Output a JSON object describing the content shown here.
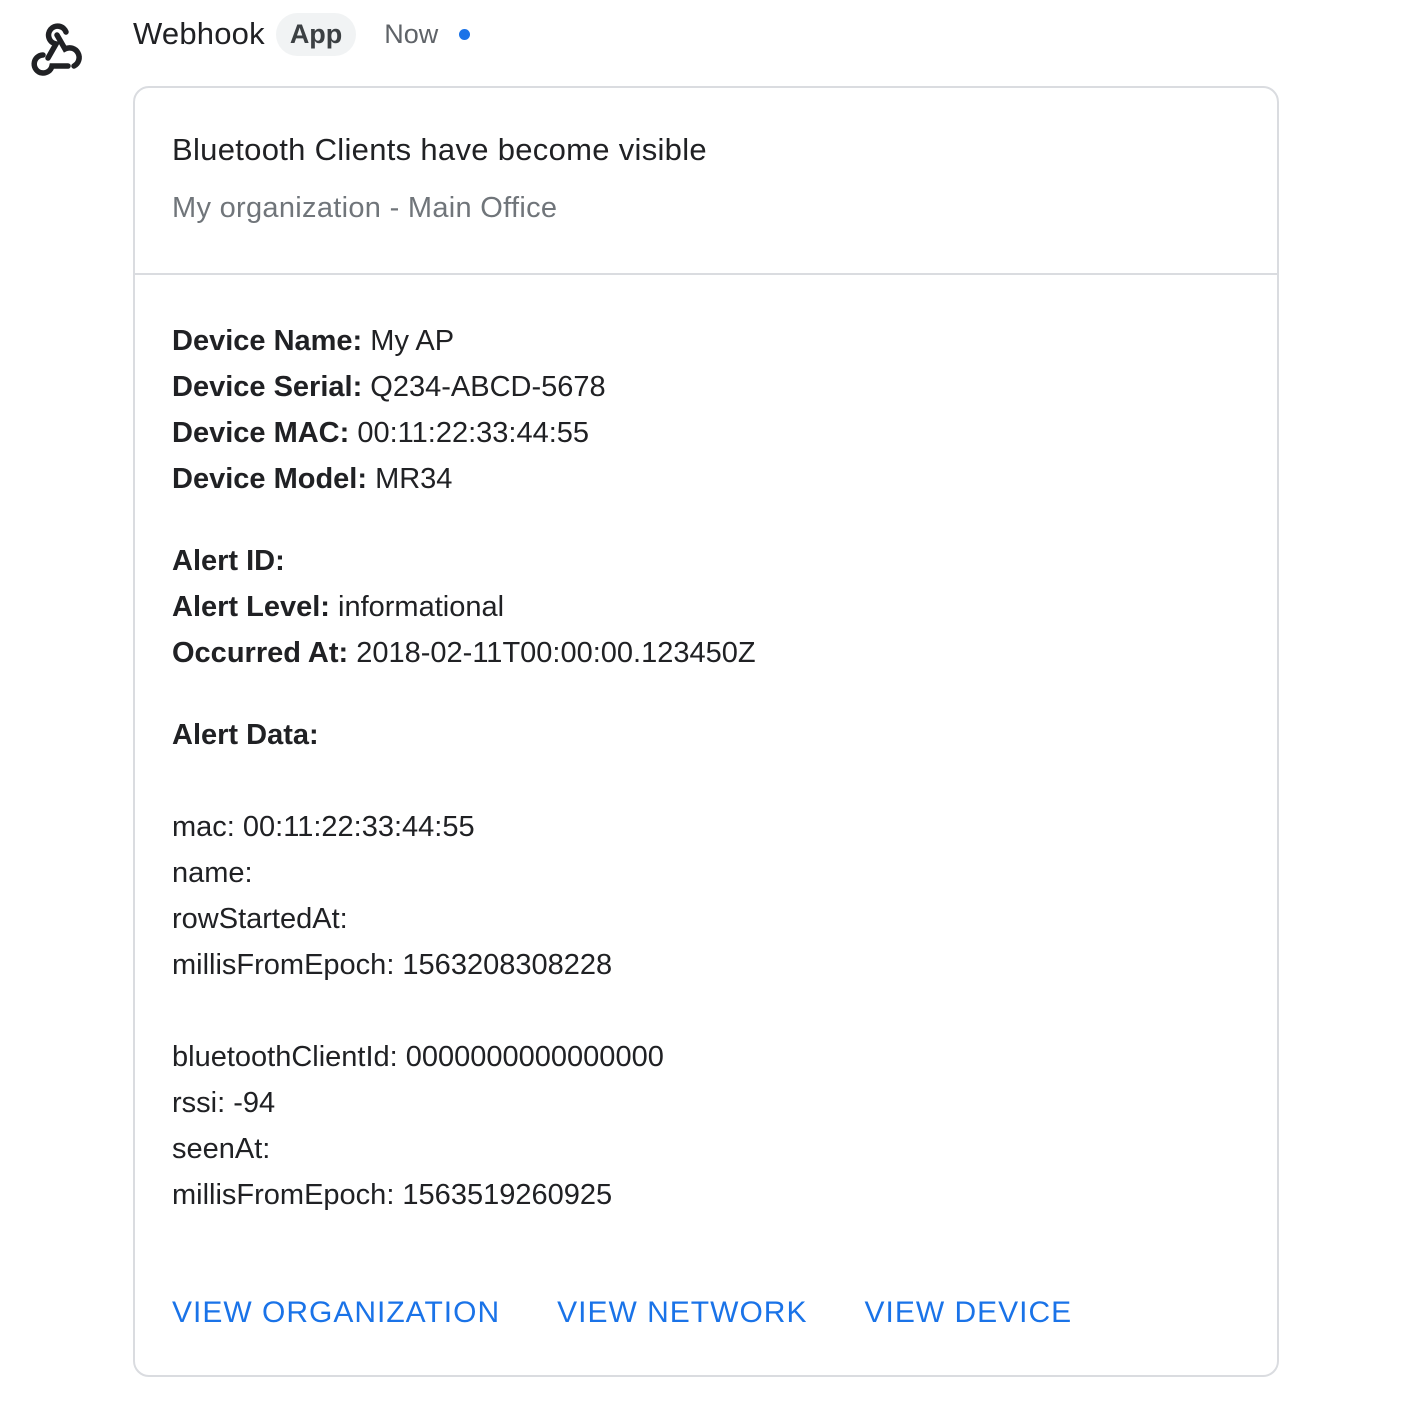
{
  "header": {
    "sender": "Webhook",
    "badge": "App",
    "timestamp": "Now",
    "avatar_icon": "webhook-icon",
    "unread_color": "#1a73e8"
  },
  "card": {
    "title": "Bluetooth Clients have become visible",
    "subtitle": "My organization - Main Office",
    "device": [
      {
        "label": "Device Name:",
        "value": "My AP"
      },
      {
        "label": "Device Serial:",
        "value": "Q234-ABCD-5678"
      },
      {
        "label": "Device MAC:",
        "value": "00:11:22:33:44:55"
      },
      {
        "label": "Device Model:",
        "value": "MR34"
      }
    ],
    "alert": [
      {
        "label": "Alert ID:",
        "value": ""
      },
      {
        "label": "Alert Level:",
        "value": "informational"
      },
      {
        "label": "Occurred At:",
        "value": "2018-02-11T00:00:00.123450Z"
      }
    ],
    "alert_data_label": "Alert Data:",
    "alert_data_group1": [
      "mac: 00:11:22:33:44:55",
      "name:",
      "rowStartedAt:",
      "millisFromEpoch: 1563208308228"
    ],
    "alert_data_group2": [
      "bluetoothClientId: 0000000000000000",
      "rssi: -94",
      "seenAt:",
      "millisFromEpoch: 1563519260925"
    ],
    "actions": [
      "VIEW ORGANIZATION",
      "VIEW NETWORK",
      "VIEW DEVICE"
    ],
    "accent_color": "#1a73e8"
  }
}
